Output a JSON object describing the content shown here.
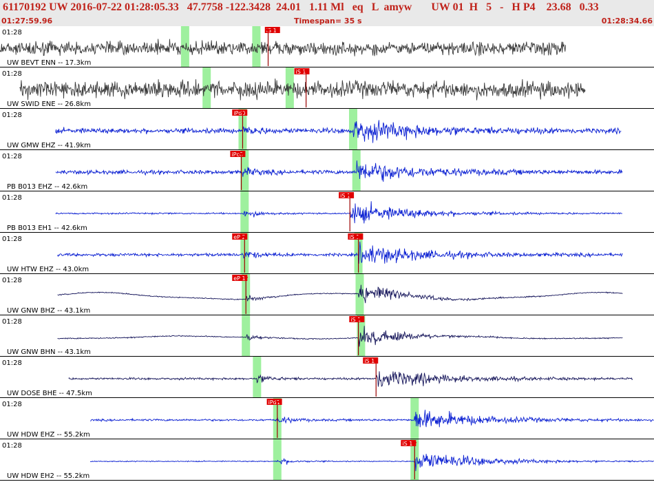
{
  "header": {
    "title": "61170192 UW 2016-07-22 01:28:05.33   47.7758 -122.3428  24.01   1.11 Ml   eq   L  amyw       UW 01  H   5   -   H P4    23.68   0.33",
    "start_time": "01:27:59.96",
    "timespan": "Timespan=  35 s",
    "end_time": "01:28:34.66"
  },
  "colors": {
    "header_text": "#c0221a",
    "header_bg": "#e9e9e9",
    "trace_gray": "#3a3a3a",
    "trace_blue": "#0a1fd2",
    "trace_navy": "#15155a",
    "pick_red": "#e00000",
    "pick_line": "#9b0000",
    "window_green": "#9ef09e"
  },
  "channels": [
    {
      "time_label": "01:28",
      "label": "UW BEVT ENN -- 17.3km",
      "color": "gray",
      "style": "noise",
      "start": 0.0,
      "end": 0.865,
      "p": 0.395,
      "s": 0.41,
      "amp": 0.24,
      "green": [
        0.283,
        0.392
      ],
      "picks": [
        {
          "text": "iS 1",
          "x": 0.405,
          "line_x": 0.41
        }
      ]
    },
    {
      "time_label": "01:28",
      "label": "UW SWID ENE -- 26.8km",
      "color": "gray",
      "style": "noise",
      "start": 0.03,
      "end": 0.895,
      "p": 0.442,
      "s": 0.468,
      "amp": 0.3,
      "green": [
        0.316,
        0.443
      ],
      "picks": [
        {
          "text": "iS 1",
          "x": 0.45,
          "line_x": 0.468
        }
      ]
    },
    {
      "time_label": "01:28",
      "label": "UW GMW EHZ -- 41.9km",
      "color": "blue",
      "style": "quake",
      "start": 0.085,
      "end": 0.95,
      "p": 0.371,
      "s": 0.54,
      "amp": 0.1,
      "green": [
        0.371,
        0.54
      ],
      "picks": [
        {
          "text": "iPd0",
          "x": 0.355,
          "line_x": 0.371
        }
      ]
    },
    {
      "time_label": "01:28",
      "label": "PB B013 EHZ -- 42.6km",
      "color": "blue",
      "style": "quake",
      "start": 0.085,
      "end": 0.952,
      "p": 0.37,
      "s": 0.545,
      "amp": 0.08,
      "green": [
        0.374,
        0.545
      ],
      "picks": [
        {
          "text": "iPc0",
          "x": 0.352,
          "line_x": 0.369
        }
      ]
    },
    {
      "time_label": "01:28",
      "label": "PB B013 EH1 -- 42.6km",
      "color": "blue",
      "style": "quake",
      "start": 0.085,
      "end": 0.952,
      "p": 0.372,
      "s": 0.535,
      "amp": 0.03,
      "green": [
        0.374
      ],
      "picks": [
        {
          "text": "iS 1",
          "x": 0.518,
          "line_x": 0.535
        }
      ]
    },
    {
      "time_label": "01:28",
      "label": "UW HTW EHZ -- 43.0km",
      "color": "blue",
      "style": "quake",
      "start": 0.088,
      "end": 0.952,
      "p": 0.372,
      "s": 0.548,
      "amp": 0.06,
      "green": [
        0.374,
        0.548
      ],
      "picks": [
        {
          "text": "eP 2",
          "x": 0.355,
          "line_x": 0.374
        },
        {
          "text": "iS 1",
          "x": 0.532,
          "line_x": 0.548
        }
      ]
    },
    {
      "time_label": "01:28",
      "label": "UW GNW BHZ -- 43.1km",
      "color": "navy",
      "style": "wave",
      "start": 0.088,
      "end": 0.952,
      "p": 0.376,
      "s": 0.548,
      "amp": 0.1,
      "green": [
        0.376,
        0.55
      ],
      "picks": [
        {
          "text": "eP 1",
          "x": 0.355,
          "line_x": 0.376
        }
      ]
    },
    {
      "time_label": "01:28",
      "label": "UW GNW BHN -- 43.1km",
      "color": "navy",
      "style": "wave",
      "start": 0.088,
      "end": 0.952,
      "p": 0.376,
      "s": 0.548,
      "amp": 0.04,
      "green": [
        0.376,
        0.552
      ],
      "picks": [
        {
          "text": "iS 1",
          "x": 0.534,
          "line_x": 0.548
        }
      ]
    },
    {
      "time_label": "01:28",
      "label": "UW DOSE BHE -- 47.5km",
      "color": "navy",
      "style": "quake",
      "start": 0.105,
      "end": 0.968,
      "p": 0.393,
      "s": 0.575,
      "amp": 0.04,
      "green": [
        0.393
      ],
      "picks": [
        {
          "text": "iS 1",
          "x": 0.555,
          "line_x": 0.575
        }
      ]
    },
    {
      "time_label": "01:28",
      "label": "UW HDW EHZ -- 55.2km",
      "color": "blue",
      "style": "quake",
      "start": 0.138,
      "end": 1.0,
      "p": 0.424,
      "s": 0.634,
      "amp": 0.04,
      "green": [
        0.424,
        0.634
      ],
      "picks": [
        {
          "text": "iPd1",
          "x": 0.408,
          "line_x": 0.424
        }
      ]
    },
    {
      "time_label": "01:28",
      "label": "UW HDW EH2 -- 55.2km",
      "color": "blue",
      "style": "quake",
      "start": 0.138,
      "end": 1.0,
      "p": 0.424,
      "s": 0.634,
      "amp": 0.02,
      "green": [
        0.424,
        0.634
      ],
      "picks": [
        {
          "text": "iS 1",
          "x": 0.613,
          "line_x": 0.634
        }
      ]
    }
  ]
}
